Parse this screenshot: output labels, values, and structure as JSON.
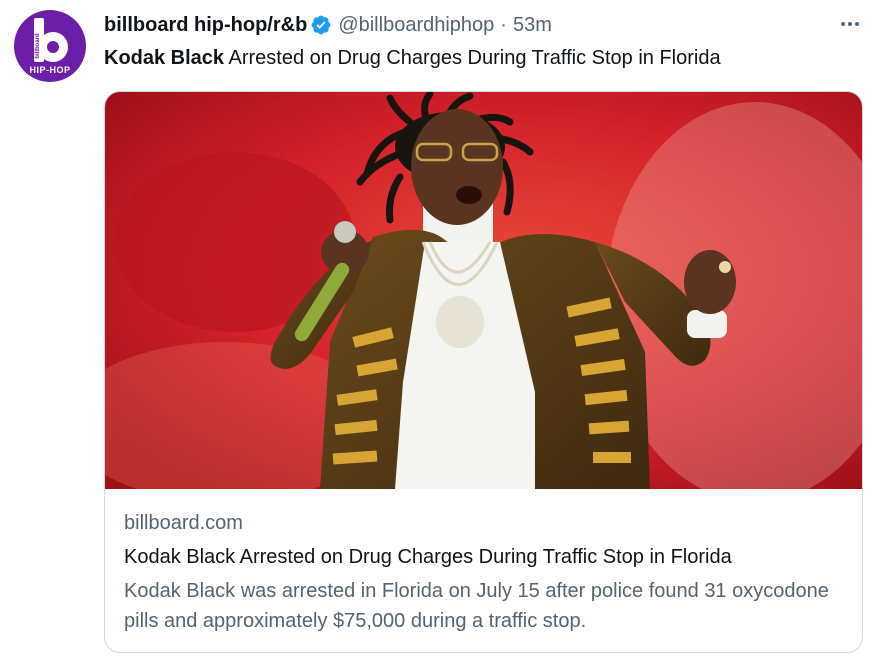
{
  "account": {
    "display_name": "billboard hip-hop/r&b",
    "handle": "@billboardhiphop",
    "separator": "·",
    "timestamp": "53m",
    "verified": true,
    "avatar_brand": "billboard",
    "avatar_label": "HIP-HOP"
  },
  "tweet": {
    "text_bold": "Kodak Black",
    "text_rest": " Arrested on Drug Charges During Traffic Stop in Florida"
  },
  "card": {
    "domain": "billboard.com",
    "title": "Kodak Black Arrested on Drug Charges During Traffic Stop in Florida",
    "description": "Kodak Black was arrested in Florida on July 15 after police found 31 oxycodone pills and approximately $75,000 during a traffic stop."
  },
  "icons": {
    "more": "more-horizontal-icon",
    "verified": "verified-badge-icon",
    "avatar": "billboard-b-logo"
  },
  "colors": {
    "text_primary": "#0f1419",
    "text_secondary": "#536471",
    "border": "#cfd9de",
    "verified_blue": "#1d9bf0",
    "avatar_purple": "#6b1fa8",
    "photo_background_red": "#d4212a"
  }
}
